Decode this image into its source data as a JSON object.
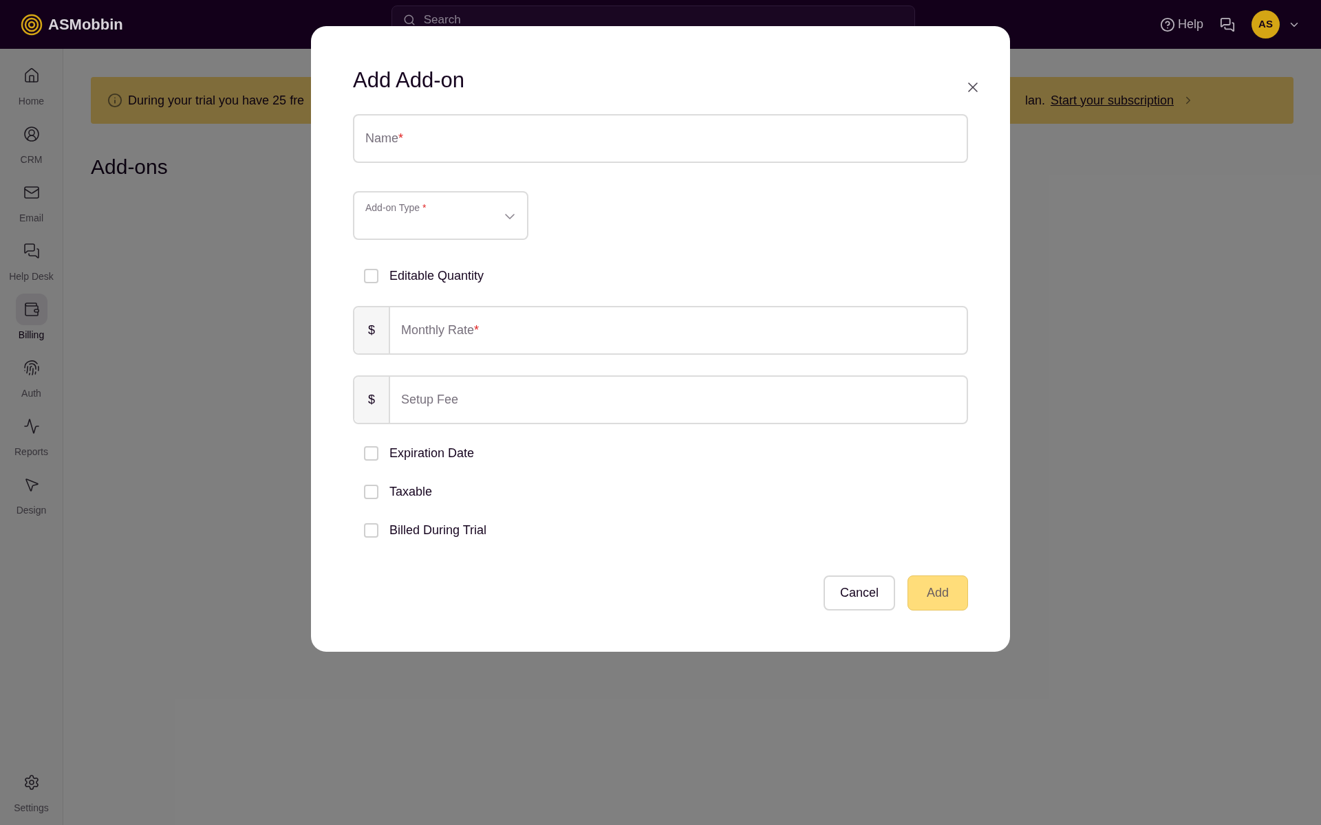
{
  "topbar": {
    "brand": "ASMobbin",
    "search": {
      "placeholder": "Search"
    },
    "help": "Help",
    "avatar": "AS"
  },
  "sidebar": {
    "items": [
      {
        "label": "Home",
        "selected": false
      },
      {
        "label": "CRM",
        "selected": false
      },
      {
        "label": "Email",
        "selected": false
      },
      {
        "label": "Help Desk",
        "selected": false
      },
      {
        "label": "Billing",
        "selected": true
      },
      {
        "label": "Auth",
        "selected": false
      },
      {
        "label": "Reports",
        "selected": false
      },
      {
        "label": "Design",
        "selected": false
      }
    ],
    "footer": {
      "label": "Settings",
      "selected": false
    }
  },
  "banner": {
    "text_start": "During your trial you have 25 fre",
    "text_end": "lan.",
    "link": "Start your subscription"
  },
  "page_title": "Add-ons",
  "dialog": {
    "title": "Add Add-on",
    "fields": [
      {
        "kind": "text",
        "placeholder": "Name",
        "required_mark": "*"
      },
      {
        "kind": "select",
        "label": "Add-on Type",
        "required_mark": "*"
      },
      {
        "kind": "checkbox",
        "label": "Editable Quantity",
        "checked": false
      },
      {
        "kind": "currency",
        "prefix": "$",
        "placeholder": "Monthly Rate",
        "required_mark": "*"
      },
      {
        "kind": "currency",
        "prefix": "$",
        "placeholder": "Setup Fee"
      },
      {
        "kind": "checkbox",
        "label": "Expiration Date",
        "checked": false
      },
      {
        "kind": "checkbox",
        "label": "Taxable",
        "checked": false
      },
      {
        "kind": "checkbox",
        "label": "Billed During Trial",
        "checked": false
      }
    ],
    "buttons": [
      {
        "kind": "secondary",
        "label": "Cancel"
      },
      {
        "kind": "primary",
        "label": "Add"
      }
    ]
  }
}
